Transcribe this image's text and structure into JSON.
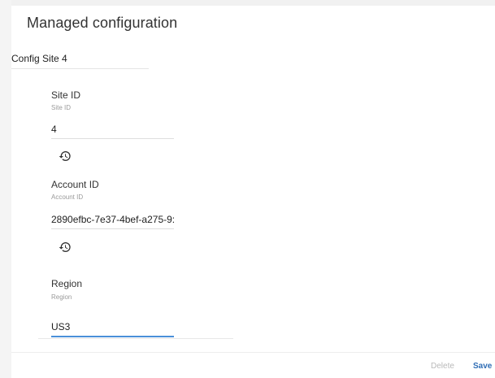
{
  "dialog": {
    "title": "Managed configuration",
    "config_name": "Config Site 4"
  },
  "fields": [
    {
      "label": "Site ID",
      "sublabel": "Site ID",
      "value": "4",
      "reset_icon": "history-icon"
    },
    {
      "label": "Account ID",
      "sublabel": "Account ID",
      "value": "2890efbc-7e37-4bef-a275-9:",
      "reset_icon": "history-icon"
    },
    {
      "label": "Region",
      "sublabel": "Region",
      "value": "US3"
    }
  ],
  "footer": {
    "delete_label": "Delete",
    "save_label": "Save"
  },
  "colors": {
    "accent": "#4a90d9",
    "save": "#2f6db5",
    "disabled": "#b9b9b9"
  }
}
